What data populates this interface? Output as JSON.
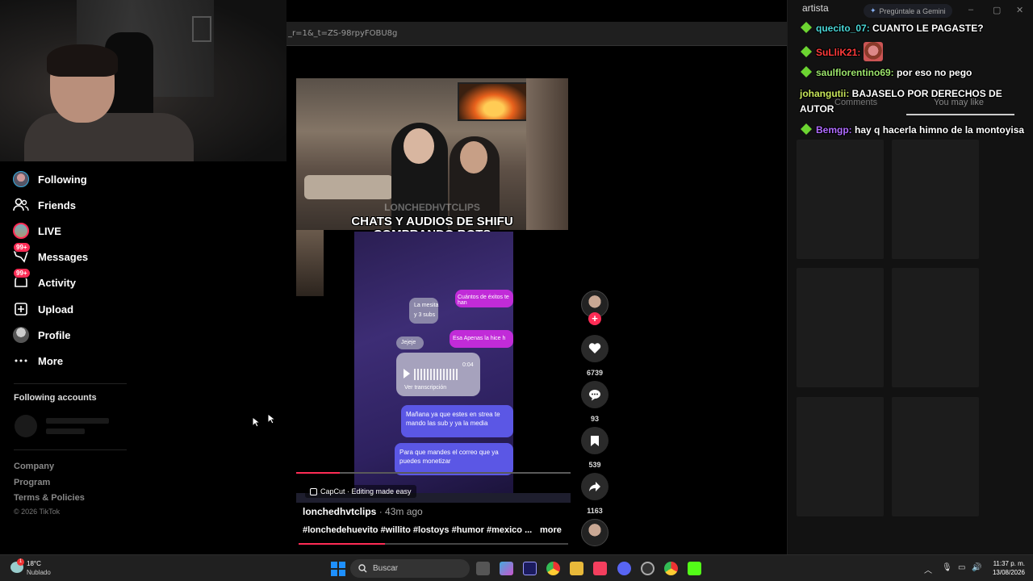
{
  "browser": {
    "url_fragment": "_r=1&_t=ZS-98rpyFOBU8g"
  },
  "sidebar": {
    "items": [
      {
        "label": "Following",
        "icon": "following-avatar-icon"
      },
      {
        "label": "Friends",
        "icon": "friends-icon"
      },
      {
        "label": "LIVE",
        "icon": "live-icon"
      },
      {
        "label": "Messages",
        "icon": "messages-icon",
        "badge": "99+"
      },
      {
        "label": "Activity",
        "icon": "activity-icon",
        "badge": "99+"
      },
      {
        "label": "Upload",
        "icon": "upload-icon"
      },
      {
        "label": "Profile",
        "icon": "profile-icon"
      },
      {
        "label": "More",
        "icon": "more-dots-icon"
      }
    ],
    "following_accounts_title": "Following accounts",
    "footer_links": [
      "Company",
      "Program",
      "Terms & Policies"
    ],
    "copyright": "© 2026 TikTok"
  },
  "video": {
    "watermark": "LONCHEDHVTCLIPS",
    "caption_line1": "CHATS Y AUDIOS DE SHIFU",
    "caption_line2": "COMPRANDO BOTS",
    "capcut_label": "CapCut · Editing made easy",
    "phone_bubbles": {
      "b1": "Cuántos de éxitos te han",
      "b2": "La mesita",
      "b3": "y 3 subs",
      "b4": "Esa Apenas la hice h",
      "b5": "Jejeje",
      "b6": "Ver transcripción",
      "b7": "Mañana ya que estes en strea te mando las sub y ya la media",
      "b8": "Para que mandes el correo que ya puedes monetizar",
      "time": "0:04"
    },
    "progress_fraction": 0.16,
    "author": "lonchedhvtclips",
    "posted": " · 43m ago",
    "hashtags": "#lonchedehuevito #willito #lostoys #humor #mexico ...",
    "more_label": "more",
    "scrub_fraction": 0.32
  },
  "actions": {
    "likes": "6739",
    "comments": "93",
    "saves": "539",
    "shares": "1163"
  },
  "right_panel": {
    "title": "artista",
    "gemini_label": "Pregúntale a Gemini",
    "tab_comments": "Comments",
    "tab_you_may_like": "You may like"
  },
  "chat": [
    {
      "user": "quecito_07:",
      "text": "CUANTO LE PAGASTE?",
      "color": "#4ad6d6",
      "badge": true
    },
    {
      "user": "SuLliK21:",
      "text": "",
      "color": "#ff3b3b",
      "badge": true,
      "emote": true
    },
    {
      "user": "saulflorentino69:",
      "text": "por eso no pego",
      "color": "#9be36b",
      "badge": true
    },
    {
      "user": "johangutii:",
      "text": "BAJASELO POR DERECHOS DE AUTOR",
      "color": "#c8e65a",
      "badge": false
    },
    {
      "user": "Bemgp:",
      "text": "hay q hacerla himno de la montoyisa",
      "color": "#b06cff",
      "badge": true
    }
  ],
  "taskbar": {
    "temperature": "18°C",
    "weather": "Nublado",
    "weather_badge": "1",
    "search_placeholder": "Buscar",
    "time": "11:37 p. m.",
    "date": "13/08/2026"
  },
  "colors": {
    "accent": "#fe2c55",
    "chat_badge_green": "#6cd431"
  }
}
